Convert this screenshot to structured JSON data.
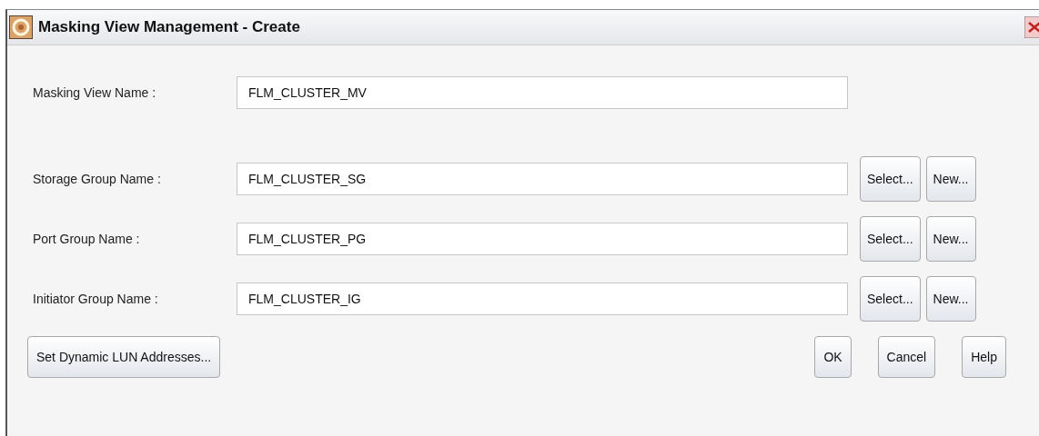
{
  "window": {
    "title": "Masking View Management - Create"
  },
  "name_field": {
    "label": "Masking View Name :",
    "value": "FLM_CLUSTER_MV"
  },
  "groups": [
    {
      "label": "Storage Group Name :",
      "value": "FLM_CLUSTER_SG",
      "buttons": [
        "Select...",
        "New..."
      ]
    },
    {
      "label": "Port Group Name :",
      "value": "FLM_CLUSTER_PG",
      "buttons": [
        "Select...",
        "New..."
      ]
    },
    {
      "label": "Initiator Group Name :",
      "value": "FLM_CLUSTER_IG",
      "buttons": [
        "Select...",
        "New..."
      ]
    }
  ],
  "left_button": "Set Dynamic LUN Addresses...",
  "buttons": [
    "OK",
    "Cancel",
    "Help"
  ]
}
